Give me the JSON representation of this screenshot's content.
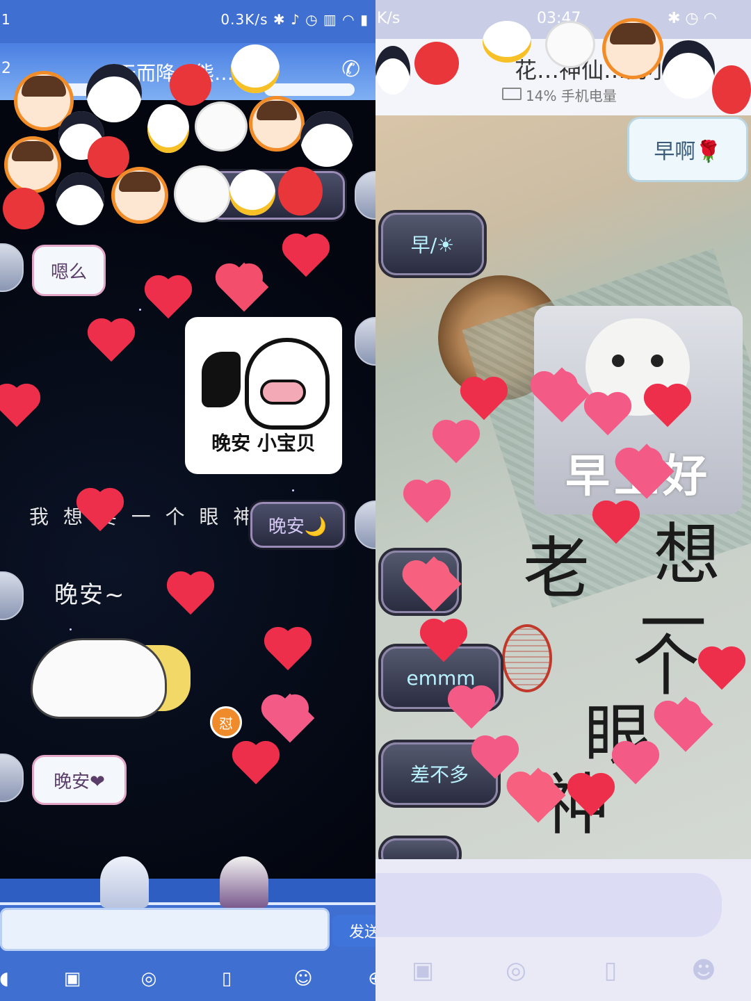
{
  "left": {
    "status": {
      "speed": "0.3K/s",
      "signal": "1"
    },
    "title": {
      "text": "…天而降…熊…大",
      "badge": "2"
    },
    "messages": {
      "m1": "嗯么",
      "sticker_caption": "晚安 小宝贝",
      "text_line": "我 想 要 一 个 眼 神，",
      "m3": "晚安🌙",
      "m4": "晚安~",
      "mini_badge": "怼",
      "m5": "晚安❤"
    },
    "send_label": "发送",
    "toolbar_icons": [
      "voice-icon",
      "picture-icon",
      "camera-icon",
      "redpacket-icon",
      "emoji-icon",
      "plus-icon"
    ]
  },
  "right": {
    "status": {
      "speed": "K/s",
      "time": "03:47"
    },
    "header": {
      "title": "花…神仙…的小…",
      "battery": "14% 手机电量"
    },
    "messages": {
      "r1": "早啊🌹",
      "r2": "早/☀",
      "cat_caption": "早上好",
      "r4": "emmm",
      "r5": "差不多"
    },
    "calligraphy": [
      "老",
      "想",
      "一",
      "个",
      "眼",
      "神"
    ],
    "toolbar_icons": [
      "picture-icon",
      "camera-icon",
      "redpacket-icon",
      "emoji-icon"
    ]
  },
  "colors": {
    "left_blue": "#3f6fd1",
    "heart_red": "#ee2f4b",
    "heart_pink": "#f35b86"
  }
}
